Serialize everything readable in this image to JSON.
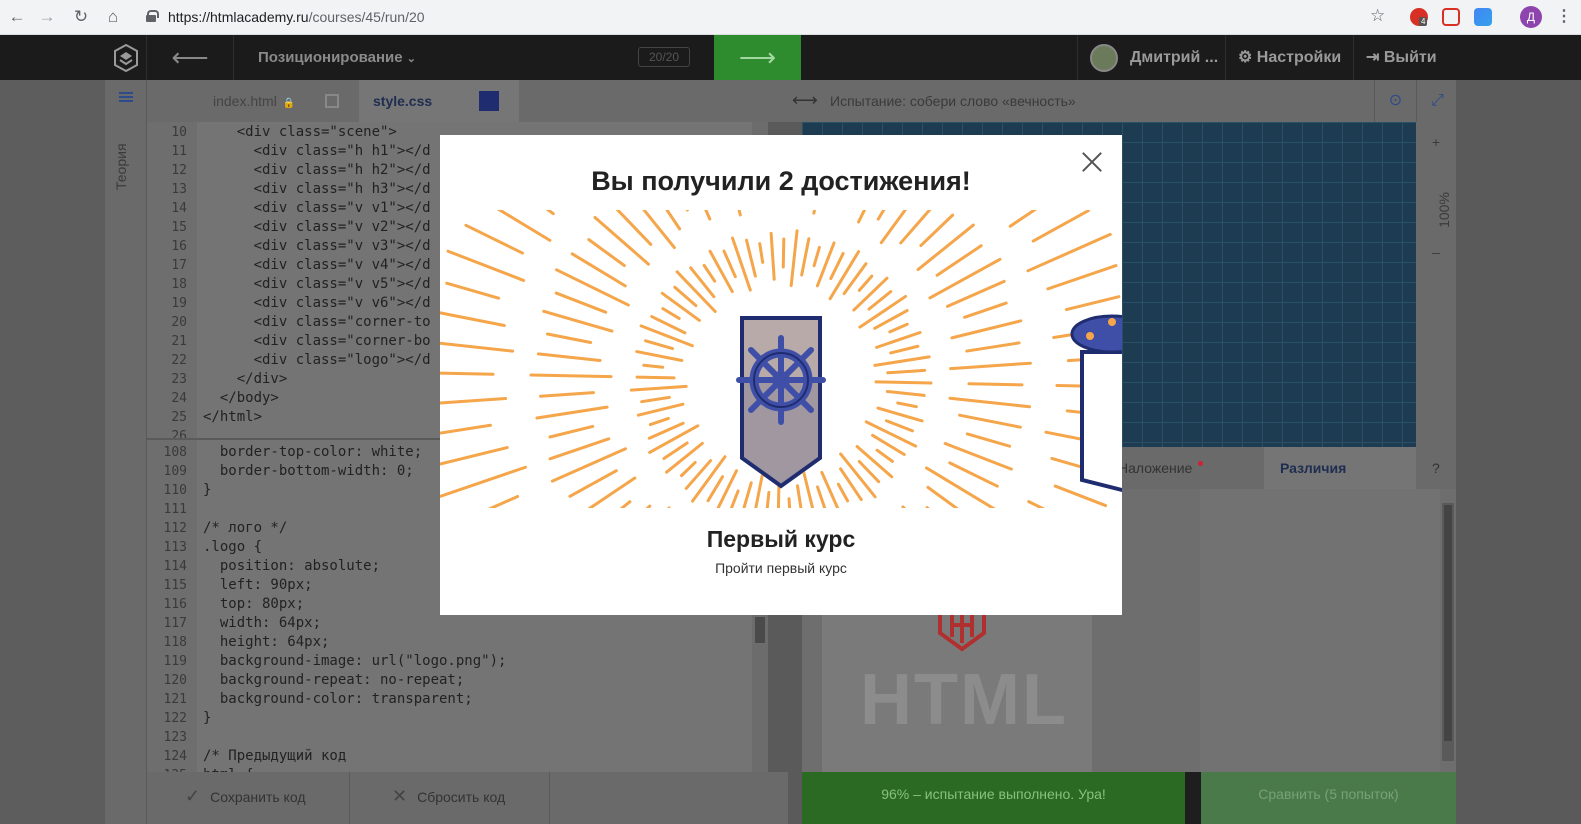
{
  "browser": {
    "url_host": "https://htmlacademy.ru",
    "url_path": "/courses/45/run/20",
    "profile_initial": "Д",
    "ext_badge": "4"
  },
  "header": {
    "prev_arrow": "⟵",
    "title": "Позиционирование",
    "counter": "20/20",
    "next_arrow": "⟶",
    "user_name": "Дмитрий ...",
    "settings": "Настройки",
    "logout": "Выйти"
  },
  "sidebar": {
    "theory_label": "Теория"
  },
  "editor": {
    "tabs": [
      {
        "label": "index.html"
      },
      {
        "label": "style.css"
      }
    ],
    "html_lines": [
      {
        "n": "10",
        "code": "    <div class=\"scene\">"
      },
      {
        "n": "11",
        "code": "      <div class=\"h h1\"></d"
      },
      {
        "n": "12",
        "code": "      <div class=\"h h2\"></d"
      },
      {
        "n": "13",
        "code": "      <div class=\"h h3\"></d"
      },
      {
        "n": "14",
        "code": "      <div class=\"v v1\"></d"
      },
      {
        "n": "15",
        "code": "      <div class=\"v v2\"></d"
      },
      {
        "n": "16",
        "code": "      <div class=\"v v3\"></d"
      },
      {
        "n": "17",
        "code": "      <div class=\"v v4\"></d"
      },
      {
        "n": "18",
        "code": "      <div class=\"v v5\"></d"
      },
      {
        "n": "19",
        "code": "      <div class=\"v v6\"></d"
      },
      {
        "n": "20",
        "code": "      <div class=\"corner-to"
      },
      {
        "n": "21",
        "code": "      <div class=\"corner-bo"
      },
      {
        "n": "22",
        "code": "      <div class=\"logo\"></d"
      },
      {
        "n": "23",
        "code": "    </div>"
      },
      {
        "n": "24",
        "code": "  </body>"
      },
      {
        "n": "25",
        "code": "</html>"
      },
      {
        "n": "26",
        "code": ""
      }
    ],
    "css_lines": [
      {
        "n": "108",
        "code": "  border-top-color: white;"
      },
      {
        "n": "109",
        "code": "  border-bottom-width: 0;"
      },
      {
        "n": "110",
        "code": "}"
      },
      {
        "n": "111",
        "code": ""
      },
      {
        "n": "112",
        "code": "/* лого */"
      },
      {
        "n": "113",
        "code": ".logo {"
      },
      {
        "n": "114",
        "code": "  position: absolute;"
      },
      {
        "n": "115",
        "code": "  left: 90px;"
      },
      {
        "n": "116",
        "code": "  top: 80px;"
      },
      {
        "n": "117",
        "code": "  width: 64px;"
      },
      {
        "n": "118",
        "code": "  height: 64px;"
      },
      {
        "n": "119",
        "code": "  background-image: url(\"logo.png\");"
      },
      {
        "n": "120",
        "code": "  background-repeat: no-repeat;"
      },
      {
        "n": "121",
        "code": "  background-color: transparent;"
      },
      {
        "n": "122",
        "code": "}"
      },
      {
        "n": "123",
        "code": ""
      },
      {
        "n": "124",
        "code": "/* Предыдущий код"
      },
      {
        "n": "125",
        "code": "html {"
      }
    ],
    "save_label": "Сохранить код",
    "reset_label": "Сбросить код"
  },
  "preview": {
    "title": "Испытание: собери слово «вечность»",
    "zoom": "100%",
    "zoom_in": "+",
    "zoom_out": "–",
    "tab_overlay": "Наложение",
    "tab_diff": "Различия",
    "help": "?",
    "html_word": "HTML",
    "status": "96% – испытание выполнено. Ура!",
    "compare_label": "Сравнить (5 попыток)"
  },
  "modal": {
    "title": "Вы получили 2 достижения!",
    "achievement_title": "Первый курс",
    "achievement_desc": "Пройти первый курс"
  },
  "colors": {
    "ray": "#f5a54a",
    "shield_navy": "#1f2d70",
    "wheel": "#3f4fa8",
    "success": "#2b6a22"
  }
}
